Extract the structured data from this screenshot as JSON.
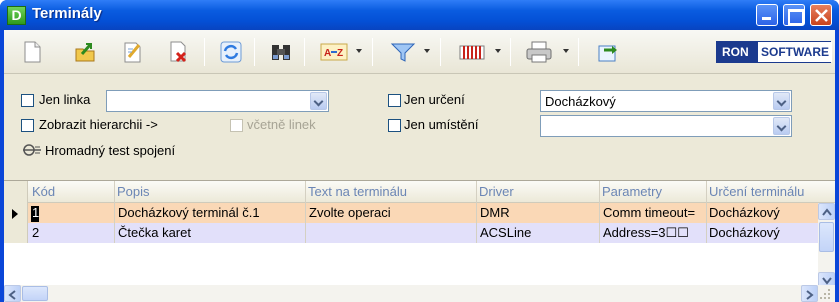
{
  "window": {
    "title": "Terminály",
    "app_icon_letter": "D",
    "colors": {
      "titlebar": "#0a5ce0",
      "client": "#ece9d8"
    }
  },
  "toolbar": {
    "items": [
      "new-document-icon",
      "open-folder-icon",
      "edit-document-icon",
      "delete-document-icon",
      "refresh-icon",
      "binoculars-icon",
      "sort-az-icon",
      "filter-icon",
      "columns-icon",
      "print-icon",
      "export-icon"
    ],
    "sort_label": "A-Z",
    "brand_left": "RON",
    "brand_right": "SOFTWARE"
  },
  "filters": {
    "jen_linka": {
      "label": "Jen linka",
      "checked": false,
      "value": ""
    },
    "jen_urceni": {
      "label": "Jen určení",
      "checked": false,
      "value": "Docházkový"
    },
    "zobrazit_hierarchii": {
      "label": "Zobrazit hierarchii ->",
      "checked": false
    },
    "vcetne_linek": {
      "label": "včetně linek",
      "checked": false,
      "disabled": true
    },
    "jen_umisteni": {
      "label": "Jen umístění",
      "checked": false,
      "value": ""
    },
    "test_link": "Hromadný test spojení"
  },
  "table": {
    "columns": [
      "Kód",
      "Popis",
      "Text na terminálu",
      "Driver",
      "Parametry",
      "Určení terminálu"
    ],
    "rows": [
      {
        "kod": "1",
        "popis": "Docházkový terminál č.1",
        "text": "Zvolte operaci",
        "driver": "DMR",
        "parametry": "Comm timeout=",
        "urceni": "Docházkový"
      },
      {
        "kod": "2",
        "popis": "Čtečka karet",
        "text": "",
        "driver": "ACSLine",
        "parametry": "Address=3☐☐",
        "urceni": "Docházkový"
      }
    ],
    "selected_row": 0,
    "row_colors": [
      "#fad8b6",
      "#e2e0fa"
    ]
  }
}
